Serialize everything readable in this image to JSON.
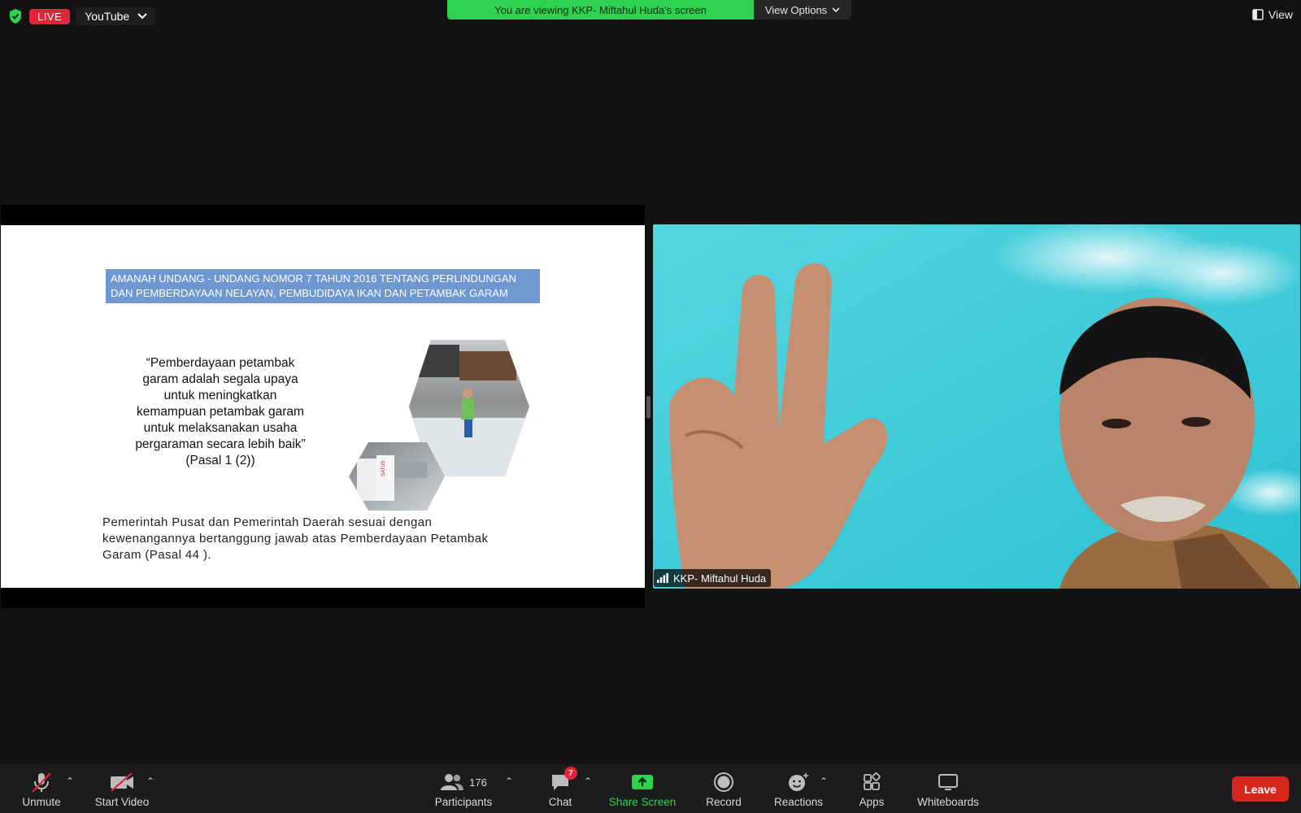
{
  "top_bar": {
    "live_label": "LIVE",
    "stream_target": "YouTube",
    "viewing_banner": "You are viewing KKP- Miftahul Huda's screen",
    "view_options_label": "View Options",
    "view_label": "View"
  },
  "slide": {
    "heading_line1": "AMANAH UNDANG - UNDANG NOMOR  7 TAHUN 2016 TENTANG PERLINDUNGAN",
    "heading_line2": "DAN PEMBERDAYAAN NELAYAN, PEMBUDIDAYA IKAN DAN PETAMBAK GARAM",
    "quote_lines": [
      "“Pemberdayaan petambak",
      "garam adalah segala upaya",
      "untuk meningkatkan",
      "kemampuan petambak garam",
      "untuk melaksanakan usaha",
      "pergaraman secara lebih baik”",
      "(Pasal 1 (2))"
    ],
    "bottom_lines": [
      "Pemerintah Pusat dan Pemerintah Daerah sesuai dengan",
      "kewenangannya bertanggung jawab atas Pemberdayaan Petambak",
      "Garam (Pasal 44 )."
    ],
    "sack_label": "SATUS"
  },
  "participant": {
    "name": "KKP- Miftahul Huda"
  },
  "toolbar": {
    "unmute": "Unmute",
    "start_video": "Start Video",
    "participants": "Participants",
    "participants_count": "176",
    "chat": "Chat",
    "chat_badge": "7",
    "share_screen": "Share Screen",
    "record": "Record",
    "reactions": "Reactions",
    "apps": "Apps",
    "whiteboards": "Whiteboards",
    "leave": "Leave"
  },
  "colors": {
    "live": "#e0263a",
    "banner_green": "#2fd250",
    "share_green": "#2fd250",
    "leave_red": "#d8261d",
    "slide_heading_blue": "#6f98d1"
  }
}
